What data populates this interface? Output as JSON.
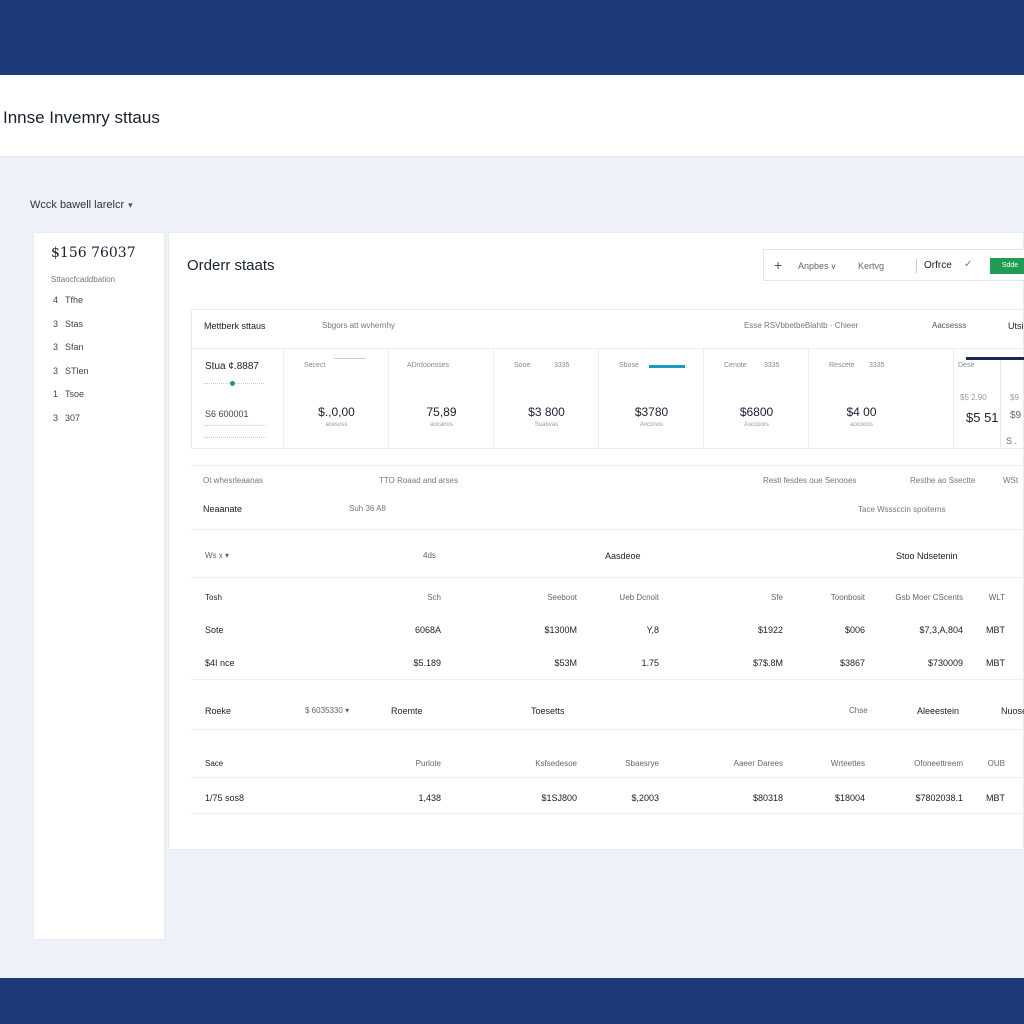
{
  "colors": {
    "band": "#1c3a7a",
    "accent_green": "#1f9d55",
    "accent_teal": "#1a9cc0",
    "navy": "#1c2a4f"
  },
  "header": {
    "title": "Innse Invemry sttaus"
  },
  "filter": {
    "label": "Wcck bawell larelcr",
    "caret_icon": "chevron-down-icon"
  },
  "sidebar": {
    "total": "$156 76037",
    "subtitle": "Sttaocfcaddbation",
    "items": [
      {
        "num": "4",
        "label": "Tfhe"
      },
      {
        "num": "3",
        "label": "Stas"
      },
      {
        "num": "3",
        "label": "Sfan"
      },
      {
        "num": "3",
        "label": "STlen"
      },
      {
        "num": "1",
        "label": "Tsoe"
      },
      {
        "num": "3",
        "label": "307"
      }
    ]
  },
  "main": {
    "title": "Orderr staats",
    "toolbar": {
      "plus_icon": "plus-icon",
      "filter1": "Anpbes",
      "filter2": "Kertvg",
      "view": "Orfrce",
      "check_icon": "check-icon",
      "button": "Sdde"
    },
    "card": {
      "head_left": "Mettberk sttaus",
      "head_mid": "Sbgors att wvhernhy",
      "head_r1": "Esse RSVbbetbeBlahtb · Chieer",
      "head_r2": "Aacsesss",
      "head_r3": "Utsi",
      "kpi0": {
        "v1": "Stua ¢.8887",
        "v2": "S6 600001"
      },
      "kpis": [
        {
          "label": "Secect",
          "sub": "",
          "value": "$.,0,00",
          "caption": "acesoss"
        },
        {
          "label": "",
          "sub": "ADrdoonsses",
          "value": "75,89",
          "caption": "aocanos"
        },
        {
          "label": "Sooe",
          "sub": "3335",
          "value": "$3 800",
          "caption": "Suabvas"
        },
        {
          "label": "Sbose",
          "sub": "",
          "value": "$3780",
          "caption": "Anconos"
        },
        {
          "label": "Cenote",
          "sub": "3335",
          "value": "$6800",
          "caption": "Asccoors"
        },
        {
          "label": "Rescete",
          "sub": "3335",
          "value": "$4 00",
          "caption": "aocooos"
        }
      ],
      "kpiR": {
        "label": "Dese",
        "a": "$5 2.90",
        "b": "$5 51",
        "c": "$9",
        "d": "$9",
        "e": "S ."
      }
    },
    "row1": {
      "left": "Ot whesrleaanas",
      "mid": "TTO Roaad and arses",
      "r1": "Resti fesdes oue Senooes",
      "r2": "Resthe ao Ssectte",
      "r3": "WSt"
    },
    "row2": {
      "left": "Neaanate",
      "mid": "Suh 36 A8",
      "right": "Tace Wsssccin spoiterns"
    },
    "table1": {
      "header": {
        "filter": "Ws",
        "x": "x",
        "c2": "4ds",
        "c3": "Aasdeoe",
        "c4": "Stoo Ndsetenin"
      },
      "columns": [
        "Tosh",
        "Sch",
        "Seeboot",
        "Ueb Dcnoit",
        "Sfe",
        "Toonbosit",
        "Gsb Moer CScents",
        "WLT"
      ],
      "rows": [
        [
          "Sote",
          "6068A",
          "$1300M",
          "Y,8",
          "$1922",
          "$006",
          "$7,3,A,804",
          "MBT"
        ],
        [
          "$4I nce",
          "$5.189",
          "$53M",
          "1.75",
          "$7$.8M",
          "$3867",
          "$730009",
          "MBT"
        ]
      ]
    },
    "table2": {
      "header": {
        "c1": "Roeke",
        "filter": "$ 6035330",
        "c3": "Roemte",
        "c4": "Toesetts",
        "c5": "Chse",
        "c6": "Aleeestein",
        "c7": "Nuose"
      },
      "columns": [
        "Sace",
        "Purlote",
        "Ksfsedesoe",
        "Sbaesrye",
        "Aaeer Darees",
        "Wrteettes",
        "Ofoneettreem",
        "OUB"
      ],
      "rows": [
        [
          "1/75 sos8",
          "1,438",
          "$1SJ800",
          "$,2003",
          "$80318",
          "$18004",
          "$7802038.1",
          "MBT"
        ]
      ]
    }
  }
}
